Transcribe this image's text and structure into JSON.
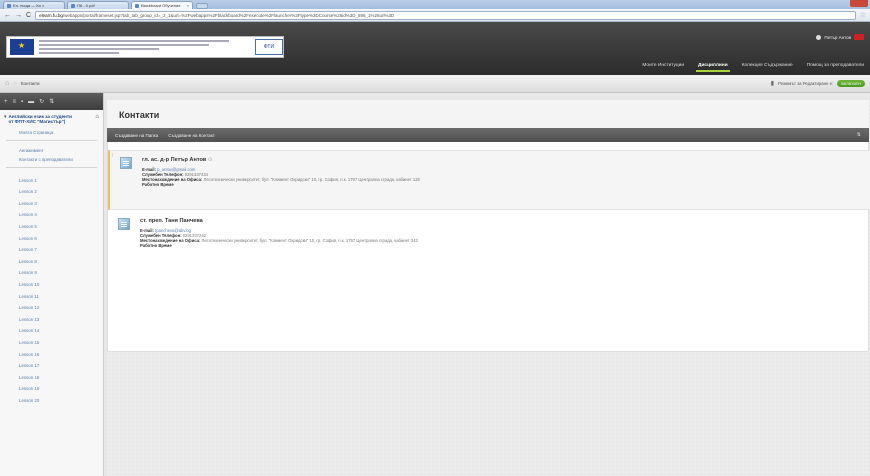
{
  "browser": {
    "tabs": [
      {
        "label": "Ел. поща — Ко ×",
        "active": false
      },
      {
        "label": "П8 - 0 pdf",
        "active": false
      },
      {
        "label": "Blackboard Обучение",
        "active": true
      }
    ],
    "back": "←",
    "forward": "→",
    "reload": "C",
    "url_host": "elearn.fu.bg",
    "url_path": "/webapps/portal/frameset.jsp?tab_tab_group_id=_2_1&url=%2Fwebapps%2Fblackboard%2Fexecute%2Flauncher%3Ftype%3DCourse%26id%3D_895_1%26url%3D",
    "star": "☆"
  },
  "header": {
    "user_name": "Петър Антов",
    "banner_logo": "ФТИ",
    "nav": [
      {
        "label": "Моите Институции",
        "active": false
      },
      {
        "label": "Дисциплини",
        "active": true
      },
      {
        "label": "Колекция Съдържание",
        "active": false
      },
      {
        "label": "Помощ за преподаватели",
        "active": false
      }
    ]
  },
  "breadcrumb": {
    "home_icon": "⌂",
    "current": "Контакти",
    "edit_mode_label": "Режимът за Редактиране е:",
    "edit_mode_value": "ВКЛЮЧЕН"
  },
  "sidebar": {
    "course_title": "Английски език за студенти от ФПТ-ХИС \"Магистър\")",
    "links": [
      "Моята Страница",
      "Ангажимент",
      "Контакти с преподаватели"
    ],
    "lessons": [
      "Lesson 1",
      "Lesson 2",
      "Lesson 3",
      "Lesson 4",
      "Lesson 5",
      "Lesson 6",
      "Lesson 7",
      "Lesson 8",
      "Lesson 9",
      "Lesson 10",
      "Lesson 11",
      "Lesson 12",
      "Lesson 13",
      "Lesson 14",
      "Lesson 15",
      "Lesson 16",
      "Lesson 17",
      "Lesson 18",
      "Lesson 19",
      "Lesson 20"
    ]
  },
  "page": {
    "title": "Контакти",
    "actions": [
      "Създаване на Папка",
      "Създаване на Контакт"
    ]
  },
  "contacts": [
    {
      "name": "гл. ас. д-р Петър Антов",
      "email_label": "E-mail:",
      "email": "p_antov@gmail.com",
      "phone_label": "Служебен Телефон:",
      "phone": "0291337434",
      "office_label": "Местонахождение на Офиса:",
      "office": "Лесотехнически университет, бул. \"Климент Охридски\" 10, гр. София, п.к. 1797 Централна сграда, кабинет 126",
      "hours_label": "Работно Време"
    },
    {
      "name": "ст. преп. Таня Панчева",
      "email_label": "E-mail:",
      "email": "tpancheva@abv.bg",
      "phone_label": "Служебен Телефон:",
      "phone": "0291337242",
      "office_label": "Местонахождение на Офиса:",
      "office": "Лесотехнически университет, бул. \"Климент Охридски\" 10, гр. София, п.к. 1797 Централна сграда, кабинет 343",
      "hours_label": "Работно Време"
    }
  ]
}
